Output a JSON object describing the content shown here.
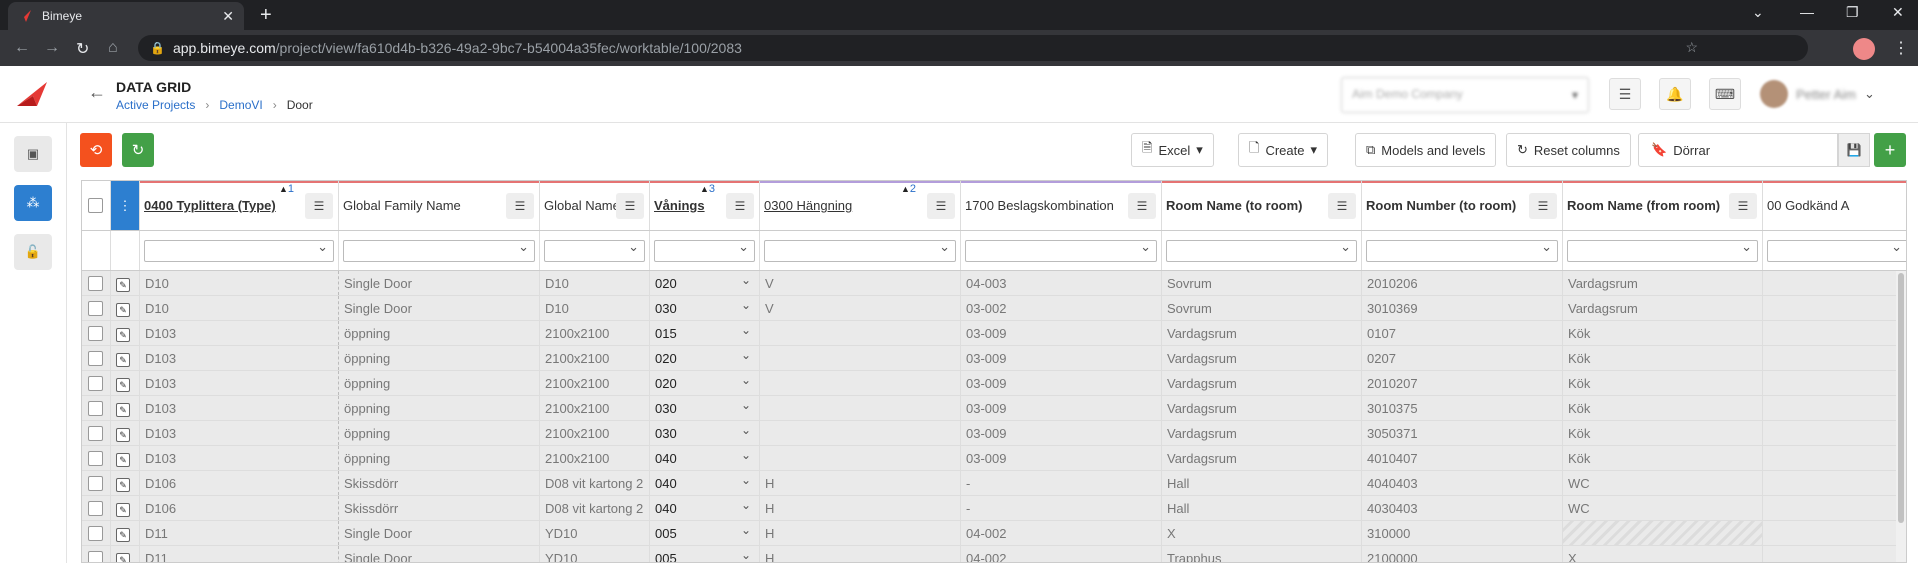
{
  "browser": {
    "tab_title": "Bimeye",
    "tab_close": "✕",
    "new_tab": "+",
    "url_host": "app.bimeye.com",
    "url_path": "/project/view/fa610d4b-b326-49a2-9bc7-b54004a35fec/worktable/100/2083"
  },
  "header": {
    "title": "DATA GRID",
    "breadcrumb": [
      "Active Projects",
      "DemoVI",
      "Door"
    ],
    "company": "Aim Demo Company",
    "user_name": "Petter Aim"
  },
  "toolbar": {
    "excel": "Excel",
    "create": "Create",
    "models_levels": "Models and levels",
    "reset_columns": "Reset columns",
    "view_name": "Dörrar"
  },
  "columns": [
    {
      "label": "0400 Typlittera (Type)",
      "sort": "1",
      "bold": true,
      "sorted": true,
      "color": "#e57373"
    },
    {
      "label": "Global Family Name",
      "sort": "",
      "bold": false,
      "sorted": false,
      "color": "#e57373"
    },
    {
      "label": "Global Name",
      "sort": "",
      "bold": false,
      "sorted": false,
      "color": "#e57373"
    },
    {
      "label": "Vånings",
      "sort": "3",
      "bold": true,
      "sorted": true,
      "color": "#e57373"
    },
    {
      "label": "0300 Hängning",
      "sort": "2",
      "bold": false,
      "sorted": true,
      "color": "#b39ddb"
    },
    {
      "label": "1700 Beslagskombination",
      "sort": "",
      "bold": false,
      "sorted": false,
      "color": "#b39ddb"
    },
    {
      "label": "Room Name (to room)",
      "sort": "",
      "bold": true,
      "sorted": false,
      "color": "#e57373"
    },
    {
      "label": "Room Number (to room)",
      "sort": "",
      "bold": true,
      "sorted": false,
      "color": "#e57373"
    },
    {
      "label": "Room Name (from room)",
      "sort": "",
      "bold": true,
      "sorted": false,
      "color": "#e57373"
    },
    {
      "label": "00 Godkänd A",
      "sort": "",
      "bold": false,
      "sorted": false,
      "color": "#e57373"
    }
  ],
  "rows": [
    [
      "D10",
      "Single Door",
      "D10",
      "020",
      "V",
      "04-003",
      "Sovrum",
      "2010206",
      "Vardagsrum",
      ""
    ],
    [
      "D10",
      "Single Door",
      "D10",
      "030",
      "V",
      "03-002",
      "Sovrum",
      "3010369",
      "Vardagsrum",
      ""
    ],
    [
      "D103",
      "öppning",
      "2100x2100",
      "015",
      "",
      "03-009",
      "Vardagsrum",
      "0107",
      "Kök",
      ""
    ],
    [
      "D103",
      "öppning",
      "2100x2100",
      "020",
      "",
      "03-009",
      "Vardagsrum",
      "0207",
      "Kök",
      ""
    ],
    [
      "D103",
      "öppning",
      "2100x2100",
      "020",
      "",
      "03-009",
      "Vardagsrum",
      "2010207",
      "Kök",
      ""
    ],
    [
      "D103",
      "öppning",
      "2100x2100",
      "030",
      "",
      "03-009",
      "Vardagsrum",
      "3010375",
      "Kök",
      ""
    ],
    [
      "D103",
      "öppning",
      "2100x2100",
      "030",
      "",
      "03-009",
      "Vardagsrum",
      "3050371",
      "Kök",
      ""
    ],
    [
      "D103",
      "öppning",
      "2100x2100",
      "040",
      "",
      "03-009",
      "Vardagsrum",
      "4010407",
      "Kök",
      ""
    ],
    [
      "D106",
      "Skissdörr",
      "D08 vit kartong 2",
      "040",
      "H",
      "-",
      "Hall",
      "4040403",
      "WC",
      ""
    ],
    [
      "D106",
      "Skissdörr",
      "D08 vit kartong 2",
      "040",
      "H",
      "-",
      "Hall",
      "4030403",
      "WC",
      ""
    ],
    [
      "D11",
      "Single Door",
      "YD10",
      "005",
      "H",
      "04-002",
      "X",
      "310000",
      "",
      ""
    ],
    [
      "D11",
      "Single Door",
      "YD10",
      "005",
      "H",
      "04-002",
      "Trapphus",
      "2100000",
      "X",
      ""
    ]
  ]
}
